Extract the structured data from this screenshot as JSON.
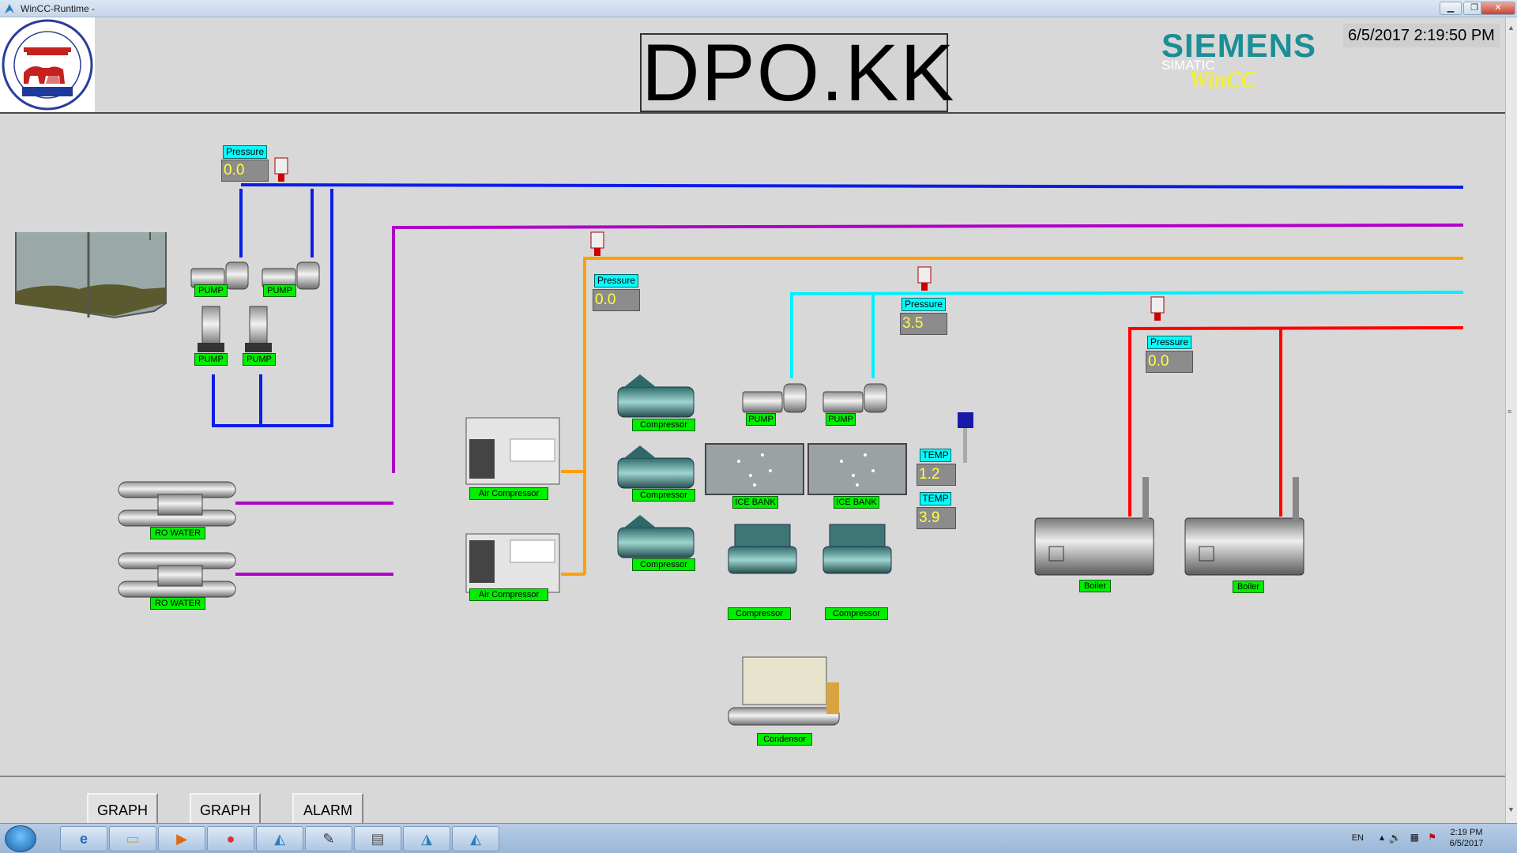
{
  "window": {
    "title": "WinCC-Runtime -"
  },
  "header": {
    "title": "DPO.KK",
    "brand": "SIEMENS",
    "product_line": "SIMATIC",
    "product": "WinCC",
    "datetime": "6/5/2017 2:19:50 PM"
  },
  "tanks": {
    "pressure_water": {
      "label": "Pressure",
      "value": "0.0"
    },
    "pressure_air": {
      "label": "Pressure",
      "value": "0.0"
    },
    "pressure_cooling": {
      "label": "Pressure",
      "value": "3.5"
    },
    "pressure_steam": {
      "label": "Pressure",
      "value": "0.0"
    },
    "temp_1": {
      "label": "TEMP",
      "value": "1.2"
    },
    "temp_2": {
      "label": "TEMP",
      "value": "3.9"
    }
  },
  "equipment_labels": {
    "pump": "PUMP",
    "ro_water": "RO WATER",
    "air_compressor": "Air Compressor",
    "compressor": "Compressor",
    "ice_bank": "ICE BANK",
    "boiler": "Boiler",
    "condensor": "Condensor"
  },
  "pipe_colors": {
    "water": "#0a1ee6",
    "ro": "#b000c8",
    "air": "#ff9f00",
    "cooling": "#00f0ff",
    "steam": "#ff0000"
  },
  "nav": {
    "graph1": "GRAPH",
    "graph2": "GRAPH",
    "alarm": "ALARM"
  },
  "taskbar": {
    "lang": "EN",
    "time": "2:19 PM",
    "date": "6/5/2017"
  }
}
